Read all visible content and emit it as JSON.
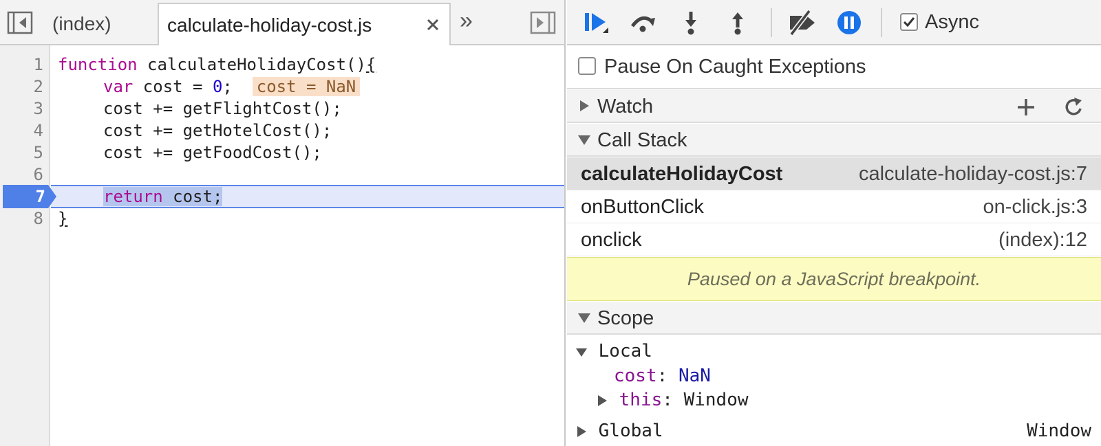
{
  "tabs": {
    "index_label": "(index)",
    "active_label": "calculate-holiday-cost.js",
    "more_label": "»"
  },
  "editor": {
    "line_numbers": [
      "1",
      "2",
      "3",
      "4",
      "5",
      "6",
      "7",
      "8"
    ],
    "execution_line": "7",
    "lines": {
      "l1_kw": "function",
      "l1_rest": " calculateHolidayCost()",
      "l1_brace": "{",
      "l2_kw": "var",
      "l2_mid": " cost = ",
      "l2_num": "0",
      "l2_end": ";",
      "l2_inline": "cost = NaN",
      "l3": "cost += getFlightCost();",
      "l4": "cost += getHotelCost();",
      "l5": "cost += getFoodCost();",
      "l7_kw": "return",
      "l7_rest": " cost;",
      "l8": "}"
    }
  },
  "toolbar": {
    "async_label": "Async",
    "async_checked": true,
    "accent": "#1a73e8"
  },
  "pause_on_caught": {
    "label": "Pause On Caught Exceptions",
    "checked": false
  },
  "sections": {
    "watch": "Watch",
    "call_stack": "Call Stack",
    "scope": "Scope"
  },
  "call_stack": [
    {
      "fn": "calculateHolidayCost",
      "loc": "calculate-holiday-cost.js:7",
      "selected": true
    },
    {
      "fn": "onButtonClick",
      "loc": "on-click.js:3",
      "selected": false
    },
    {
      "fn": "onclick",
      "loc": "(index):12",
      "selected": false
    }
  ],
  "paused_message": "Paused on a JavaScript breakpoint.",
  "scope": {
    "local_label": "Local",
    "cost_name": "cost",
    "cost_value": "NaN",
    "this_name": "this",
    "this_value": "Window",
    "global_label": "Global",
    "global_value": "Window"
  }
}
